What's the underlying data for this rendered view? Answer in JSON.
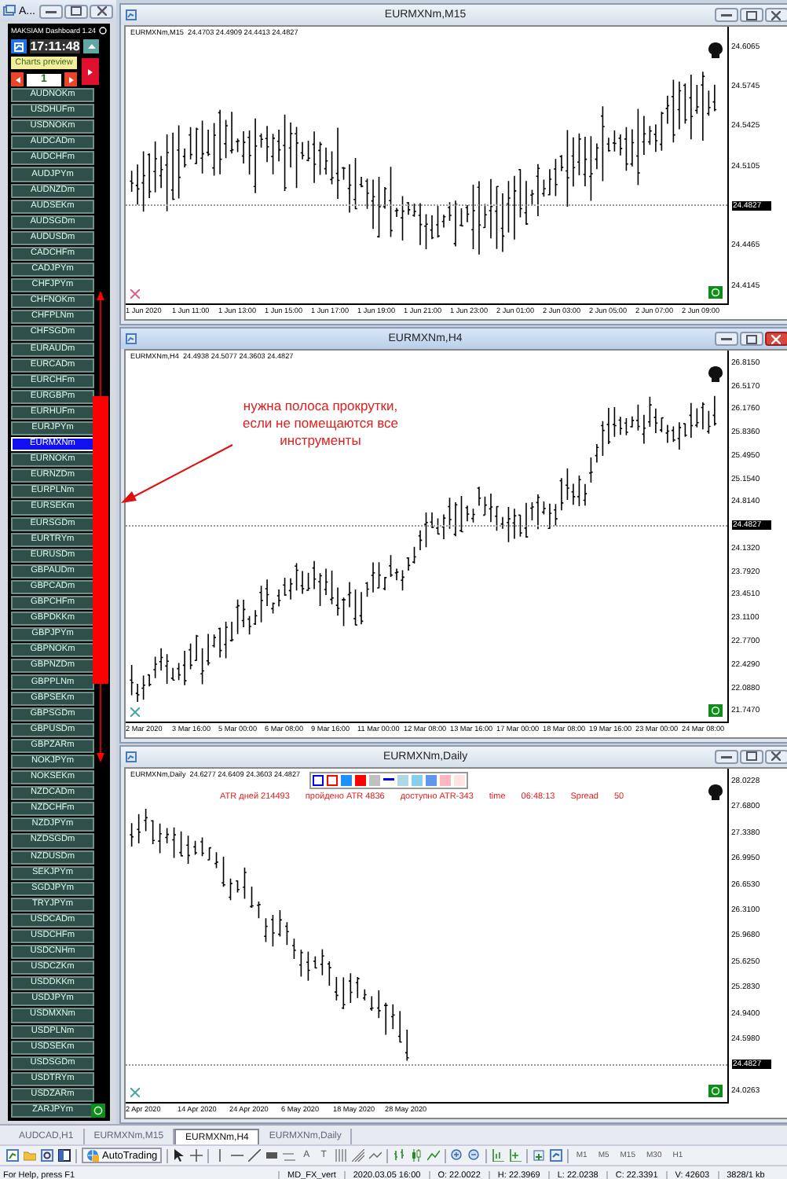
{
  "dashboard": {
    "window_title": "A...",
    "title": "MAKSIAM Dashboard 1.24",
    "clock": "17:11:48",
    "preview_label": "Charts preview",
    "page": "1",
    "symbols": [
      {
        "label": "AUDNOKm",
        "selected": false
      },
      {
        "label": "USDHUFm",
        "selected": false
      },
      {
        "label": "USDNOKm",
        "selected": false
      },
      {
        "label": "AUDCADm",
        "selected": false
      },
      {
        "label": "AUDCHFm",
        "selected": false
      },
      {
        "label": "AUDJPYm",
        "selected": false
      },
      {
        "label": "AUDNZDm",
        "selected": false
      },
      {
        "label": "AUDSEKm",
        "selected": false
      },
      {
        "label": "AUDSGDm",
        "selected": false
      },
      {
        "label": "AUDUSDm",
        "selected": false
      },
      {
        "label": "CADCHFm",
        "selected": false
      },
      {
        "label": "CADJPYm",
        "selected": false
      },
      {
        "label": "CHFJPYm",
        "selected": false
      },
      {
        "label": "CHFNOKm",
        "selected": false
      },
      {
        "label": "CHFPLNm",
        "selected": false
      },
      {
        "label": "CHFSGDm",
        "selected": false
      },
      {
        "label": "EURAUDm",
        "selected": false
      },
      {
        "label": "EURCADm",
        "selected": false
      },
      {
        "label": "EURCHFm",
        "selected": false
      },
      {
        "label": "EURGBPm",
        "selected": false
      },
      {
        "label": "EURHUFm",
        "selected": false
      },
      {
        "label": "EURJPYm",
        "selected": false
      },
      {
        "label": "EURMXNm",
        "selected": true
      },
      {
        "label": "EURNOKm",
        "selected": false
      },
      {
        "label": "EURNZDm",
        "selected": false
      },
      {
        "label": "EURPLNm",
        "selected": false
      },
      {
        "label": "EURSEKm",
        "selected": false
      },
      {
        "label": "EURSGDm",
        "selected": false
      },
      {
        "label": "EURTRYm",
        "selected": false
      },
      {
        "label": "EURUSDm",
        "selected": false
      },
      {
        "label": "GBPAUDm",
        "selected": false
      },
      {
        "label": "GBPCADm",
        "selected": false
      },
      {
        "label": "GBPCHFm",
        "selected": false
      },
      {
        "label": "GBPDKKm",
        "selected": false
      },
      {
        "label": "GBPJPYm",
        "selected": false
      },
      {
        "label": "GBPNOKm",
        "selected": false
      },
      {
        "label": "GBPNZDm",
        "selected": false
      },
      {
        "label": "GBPPLNm",
        "selected": false
      },
      {
        "label": "GBPSEKm",
        "selected": false
      },
      {
        "label": "GBPSGDm",
        "selected": false
      },
      {
        "label": "GBPUSDm",
        "selected": false
      },
      {
        "label": "GBPZARm",
        "selected": false
      },
      {
        "label": "NOKJPYm",
        "selected": false
      },
      {
        "label": "NOKSEKm",
        "selected": false
      },
      {
        "label": "NZDCADm",
        "selected": false
      },
      {
        "label": "NZDCHFm",
        "selected": false
      },
      {
        "label": "NZDJPYm",
        "selected": false
      },
      {
        "label": "NZDSGDm",
        "selected": false
      },
      {
        "label": "NZDUSDm",
        "selected": false
      },
      {
        "label": "SEKJPYm",
        "selected": false
      },
      {
        "label": "SGDJPYm",
        "selected": false
      },
      {
        "label": "TRYJPYm",
        "selected": false
      },
      {
        "label": "USDCADm",
        "selected": false
      },
      {
        "label": "USDCHFm",
        "selected": false
      },
      {
        "label": "USDCNHm",
        "selected": false
      },
      {
        "label": "USDCZKm",
        "selected": false
      },
      {
        "label": "USDDKKm",
        "selected": false
      },
      {
        "label": "USDJPYm",
        "selected": false
      },
      {
        "label": "USDMXNm",
        "selected": false
      },
      {
        "label": "USDPLNm",
        "selected": false
      },
      {
        "label": "USDSEKm",
        "selected": false
      },
      {
        "label": "USDSGDm",
        "selected": false
      },
      {
        "label": "USDTRYm",
        "selected": false
      },
      {
        "label": "USDZARm",
        "selected": false
      },
      {
        "label": "ZARJPYm",
        "selected": false
      }
    ]
  },
  "charts": [
    {
      "title": "EURMXNm,M15",
      "active": false,
      "info": "EURMXNm,M15  24.4703 24.4909 24.4413 24.4827",
      "price_labels": [
        {
          "text": "24.6065",
          "kind": "tick"
        },
        {
          "text": "24.5745",
          "kind": "tick"
        },
        {
          "text": "24.5425",
          "kind": "tick"
        },
        {
          "text": "24.5105",
          "kind": "tick"
        },
        {
          "text": "24.4827",
          "kind": "current"
        },
        {
          "text": "24.4465",
          "kind": "tick"
        },
        {
          "text": "24.4145",
          "kind": "tick"
        }
      ],
      "time_labels": [
        "1 Jun 2020",
        "1 Jun 11:00",
        "1 Jun 13:00",
        "1 Jun 15:00",
        "1 Jun 17:00",
        "1 Jun 19:00",
        "1 Jun 21:00",
        "1 Jun 23:00",
        "2 Jun 01:00",
        "2 Jun 03:00",
        "2 Jun 05:00",
        "2 Jun 07:00",
        "2 Jun 09:00"
      ]
    },
    {
      "title": "EURMXNm,H4",
      "active": true,
      "info": "EURMXNm,H4  24.4938 24.5077 24.3603 24.4827",
      "price_labels": [
        {
          "text": "26.8150",
          "kind": "tick"
        },
        {
          "text": "26.5170",
          "kind": "tick"
        },
        {
          "text": "26.1760",
          "kind": "tick"
        },
        {
          "text": "25.8360",
          "kind": "tick"
        },
        {
          "text": "25.4950",
          "kind": "tick"
        },
        {
          "text": "25.1540",
          "kind": "tick"
        },
        {
          "text": "24.8140",
          "kind": "tick"
        },
        {
          "text": "24.4827",
          "kind": "current"
        },
        {
          "text": "24.1320",
          "kind": "tick"
        },
        {
          "text": "23.7920",
          "kind": "tick"
        },
        {
          "text": "23.4510",
          "kind": "tick"
        },
        {
          "text": "23.1100",
          "kind": "tick"
        },
        {
          "text": "22.7700",
          "kind": "tick"
        },
        {
          "text": "22.4290",
          "kind": "tick"
        },
        {
          "text": "22.0880",
          "kind": "tick"
        },
        {
          "text": "21.7470",
          "kind": "tick"
        }
      ],
      "time_labels": [
        "2 Mar 2020",
        "3 Mar 16:00",
        "5 Mar 00:00",
        "6 Mar 08:00",
        "9 Mar 16:00",
        "11 Mar 00:00",
        "12 Mar 08:00",
        "13 Mar 16:00",
        "17 Mar 00:00",
        "18 Mar 08:00",
        "19 Mar 16:00",
        "23 Mar 00:00",
        "24 Mar 08:00"
      ]
    },
    {
      "title": "EURMXNm,Daily",
      "active": false,
      "info": "EURMXNm,Daily  24.6277 24.6409 24.3603 24.4827",
      "price_labels": [
        {
          "text": "28.0228",
          "kind": "tick"
        },
        {
          "text": "27.6800",
          "kind": "tick"
        },
        {
          "text": "27.3380",
          "kind": "tick"
        },
        {
          "text": "26.9950",
          "kind": "tick"
        },
        {
          "text": "26.6530",
          "kind": "tick"
        },
        {
          "text": "26.3100",
          "kind": "tick"
        },
        {
          "text": "25.9680",
          "kind": "tick"
        },
        {
          "text": "25.6250",
          "kind": "tick"
        },
        {
          "text": "25.2830",
          "kind": "tick"
        },
        {
          "text": "24.9400",
          "kind": "tick"
        },
        {
          "text": "24.5980",
          "kind": "tick"
        },
        {
          "text": "24.4827",
          "kind": "current"
        },
        {
          "text": "24.0263",
          "kind": "tick"
        }
      ],
      "time_labels": [
        "2 Apr 2020",
        "14 Apr 2020",
        "24 Apr 2020",
        "6 May 2020",
        "18 May 2020",
        "28 May 2020"
      ],
      "swatches": [
        {
          "kind": "outline",
          "color": "#0000ff"
        },
        {
          "kind": "outline",
          "color": "#ff0000"
        },
        {
          "kind": "fill",
          "color": "#1e90ff"
        },
        {
          "kind": "fill",
          "color": "#ff0000"
        },
        {
          "kind": "fill",
          "color": "#c0c0c0"
        },
        {
          "kind": "line",
          "color": "#0000ff"
        },
        {
          "kind": "fill",
          "color": "#add8e6"
        },
        {
          "kind": "fill",
          "color": "#87ceeb"
        },
        {
          "kind": "fill",
          "color": "#6495ed"
        },
        {
          "kind": "fill",
          "color": "#ffb6c1"
        },
        {
          "kind": "fill",
          "color": "#ffe4e1"
        }
      ],
      "stats": [
        "ATR дней 214493",
        "пройдено ATR 4836",
        "доступно ATR-343",
        "time",
        "06:48:13",
        "Spread",
        "50"
      ]
    }
  ],
  "annotation": "нужна полоса прокрутки, если не помещаются все инструменты",
  "tabs": [
    {
      "label": "AUDCAD,H1",
      "selected": false
    },
    {
      "label": "EURMXNm,M15",
      "selected": false
    },
    {
      "label": "EURMXNm,H4",
      "selected": true
    },
    {
      "label": "EURMXNm,Daily",
      "selected": false
    }
  ],
  "toolbar": {
    "autotrading": "AutoTrading",
    "text_tools": [
      "A",
      "T"
    ],
    "timeframes": [
      "M1",
      "M5",
      "M15",
      "M30",
      "H1"
    ]
  },
  "status_bar": [
    "For Help, press F1",
    "MD_FX_vert",
    "2020.03.05 16:00",
    "O: 22.0022",
    "H: 22.3969",
    "L: 22.0238",
    "C: 22.3391",
    "V: 42603",
    "3828/1 kb"
  ]
}
